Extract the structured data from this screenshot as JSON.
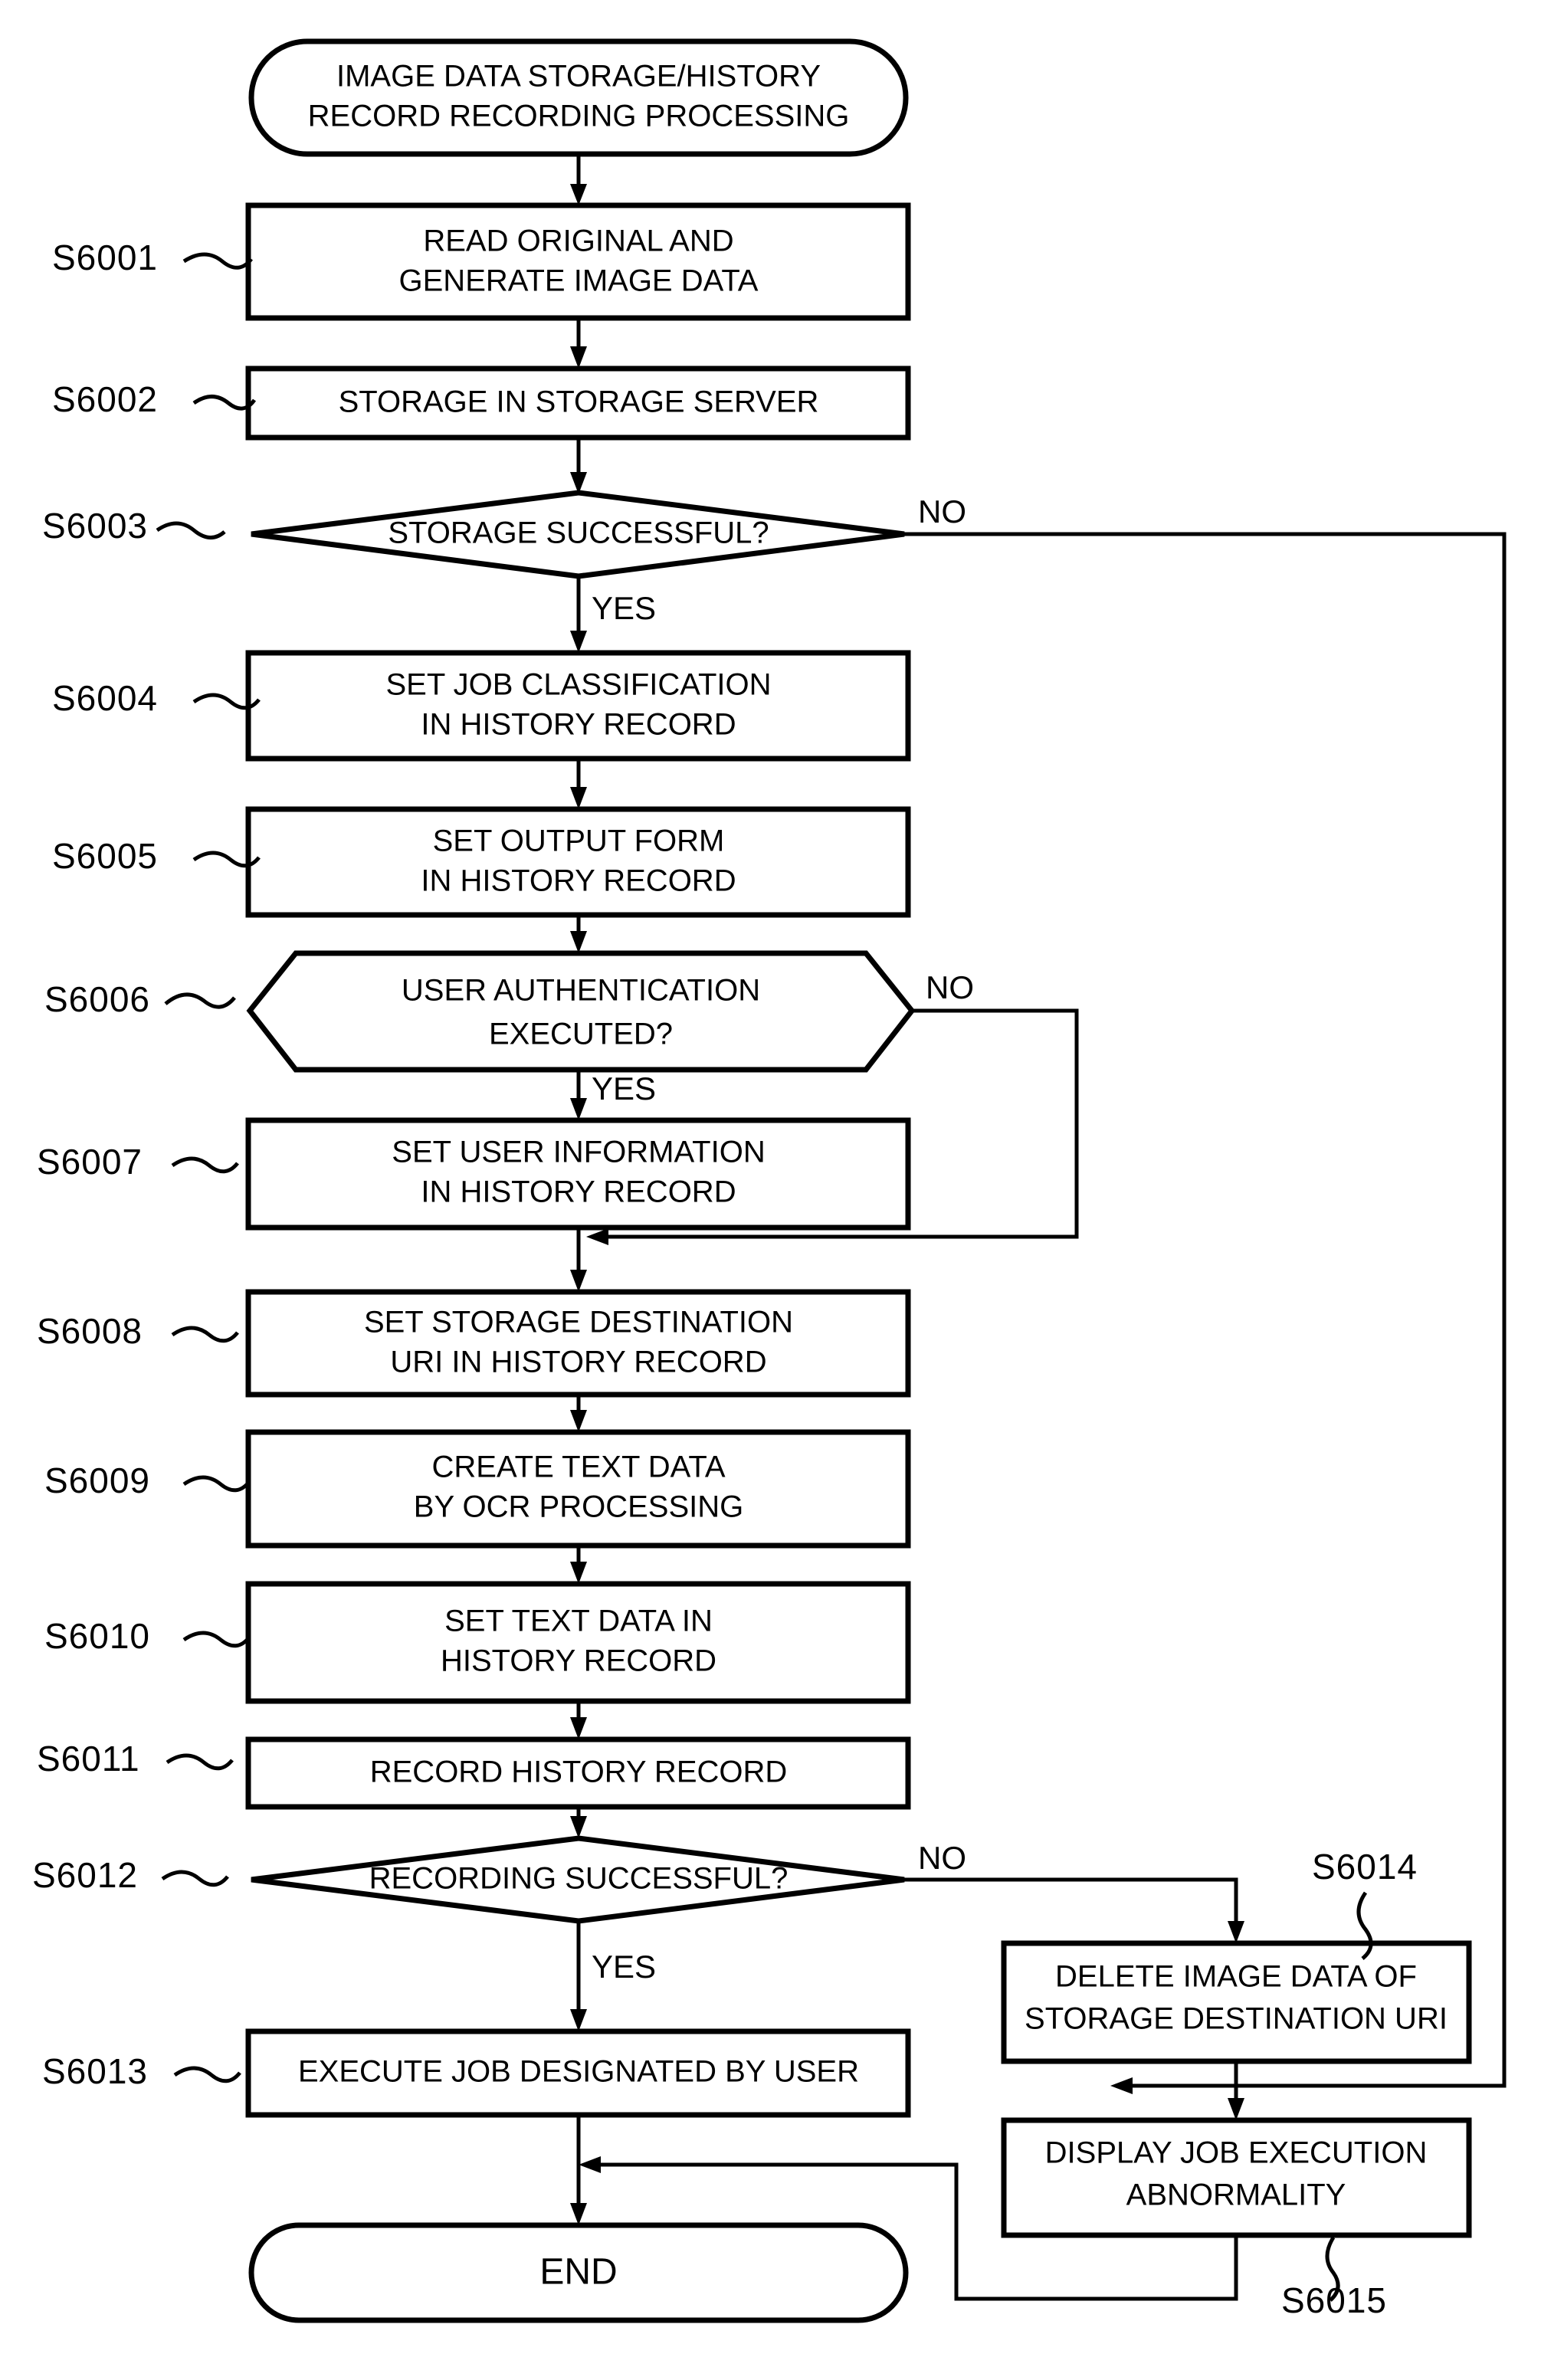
{
  "diagram": {
    "title": "IMAGE DATA STORAGE/HISTORY RECORD RECORDING PROCESSING FLOWCHART",
    "type": "flowchart",
    "colors": {
      "stroke": "#000000",
      "fill": "#ffffff",
      "text": "#000000"
    }
  },
  "nodes": {
    "start": {
      "shape": "terminal",
      "line1": "IMAGE DATA STORAGE/HISTORY",
      "line2": "RECORD RECORDING PROCESSING"
    },
    "s6001": {
      "shape": "process",
      "id": "S6001",
      "line1": "READ ORIGINAL AND",
      "line2": "GENERATE IMAGE DATA"
    },
    "s6002": {
      "shape": "process",
      "id": "S6002",
      "line1": "STORAGE IN STORAGE SERVER",
      "line2": ""
    },
    "s6003": {
      "shape": "decision",
      "id": "S6003",
      "line1": "STORAGE SUCCESSFUL?",
      "line2": "",
      "yes_label": "YES",
      "no_label": "NO"
    },
    "s6004": {
      "shape": "process",
      "id": "S6004",
      "line1": "SET JOB CLASSIFICATION",
      "line2": "IN HISTORY RECORD"
    },
    "s6005": {
      "shape": "process",
      "id": "S6005",
      "line1": "SET OUTPUT FORM",
      "line2": "IN HISTORY RECORD"
    },
    "s6006": {
      "shape": "hexagon",
      "id": "S6006",
      "line1": "USER AUTHENTICATION",
      "line2": "EXECUTED?",
      "yes_label": "YES",
      "no_label": "NO"
    },
    "s6007": {
      "shape": "process",
      "id": "S6007",
      "line1": "SET USER INFORMATION",
      "line2": "IN HISTORY RECORD"
    },
    "s6008": {
      "shape": "process",
      "id": "S6008",
      "line1": "SET STORAGE DESTINATION",
      "line2": "URI IN HISTORY RECORD"
    },
    "s6009": {
      "shape": "process",
      "id": "S6009",
      "line1": "CREATE TEXT DATA",
      "line2": "BY OCR PROCESSING"
    },
    "s6010": {
      "shape": "process",
      "id": "S6010",
      "line1": "SET TEXT DATA IN",
      "line2": "HISTORY RECORD"
    },
    "s6011": {
      "shape": "process",
      "id": "S6011",
      "line1": "RECORD HISTORY RECORD",
      "line2": ""
    },
    "s6012": {
      "shape": "decision",
      "id": "S6012",
      "line1": "RECORDING SUCCESSFUL?",
      "line2": "",
      "yes_label": "YES",
      "no_label": "NO"
    },
    "s6013": {
      "shape": "process",
      "id": "S6013",
      "line1": "EXECUTE JOB DESIGNATED BY USER",
      "line2": ""
    },
    "s6014": {
      "shape": "process",
      "id": "S6014",
      "line1": "DELETE IMAGE DATA OF",
      "line2": "STORAGE DESTINATION URI"
    },
    "s6015": {
      "shape": "process",
      "id": "S6015",
      "line1": "DISPLAY JOB EXECUTION",
      "line2": "ABNORMALITY"
    },
    "end": {
      "shape": "terminal",
      "line1": "END",
      "line2": ""
    }
  }
}
